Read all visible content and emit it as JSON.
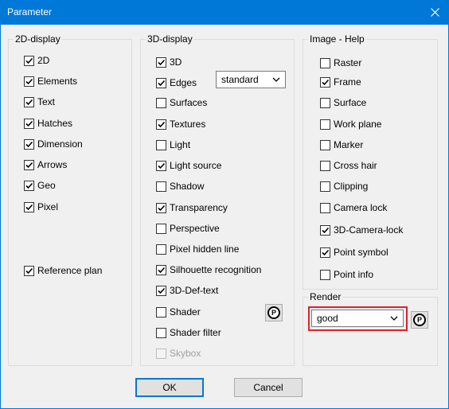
{
  "window": {
    "title": "Parameter"
  },
  "groups": {
    "display2d": {
      "label": "2D-display",
      "items": [
        {
          "label": "2D",
          "checked": true
        },
        {
          "label": "Elements",
          "checked": true
        },
        {
          "label": "Text",
          "checked": true
        },
        {
          "label": "Hatches",
          "checked": true
        },
        {
          "label": "Dimension",
          "checked": true
        },
        {
          "label": "Arrows",
          "checked": true
        },
        {
          "label": "Geo",
          "checked": true
        },
        {
          "label": "Pixel",
          "checked": true
        },
        {
          "label": "Reference plan",
          "checked": true
        }
      ]
    },
    "display3d": {
      "label": "3D-display",
      "edges_select": "standard",
      "items": [
        {
          "label": "3D",
          "checked": true
        },
        {
          "label": "Edges",
          "checked": true
        },
        {
          "label": "Surfaces",
          "checked": false
        },
        {
          "label": "Textures",
          "checked": true
        },
        {
          "label": "Light",
          "checked": false
        },
        {
          "label": "Light source",
          "checked": true
        },
        {
          "label": "Shadow",
          "checked": false
        },
        {
          "label": "Transparency",
          "checked": true
        },
        {
          "label": "Perspective",
          "checked": false
        },
        {
          "label": "Pixel hidden line",
          "checked": false
        },
        {
          "label": "Silhouette recognition",
          "checked": true
        },
        {
          "label": "3D-Def-text",
          "checked": true
        },
        {
          "label": "Shader",
          "checked": false
        },
        {
          "label": "Shader filter",
          "checked": false
        },
        {
          "label": "Skybox",
          "checked": false,
          "disabled": true
        }
      ]
    },
    "imagehelp": {
      "label": "Image - Help",
      "items": [
        {
          "label": "Raster",
          "checked": false
        },
        {
          "label": "Frame",
          "checked": true
        },
        {
          "label": "Surface",
          "checked": false
        },
        {
          "label": "Work plane",
          "checked": false
        },
        {
          "label": "Marker",
          "checked": false
        },
        {
          "label": "Cross hair",
          "checked": false
        },
        {
          "label": "Clipping",
          "checked": false
        },
        {
          "label": "Camera lock",
          "checked": false
        },
        {
          "label": "3D-Camera-lock",
          "checked": true
        },
        {
          "label": "Point symbol",
          "checked": true
        },
        {
          "label": "Point info",
          "checked": false
        }
      ]
    },
    "render": {
      "label": "Render",
      "select": "good"
    }
  },
  "p_button_glyph": "P",
  "buttons": {
    "ok": "OK",
    "cancel": "Cancel"
  },
  "colors": {
    "titlebar": "#0078d7",
    "highlight": "#e0202a",
    "default_button_border": "#0078d7"
  },
  "icons": {
    "close": "close-icon",
    "check": "checkmark-icon",
    "dropdown": "chevron-down-icon",
    "p": "p-circle-icon"
  }
}
